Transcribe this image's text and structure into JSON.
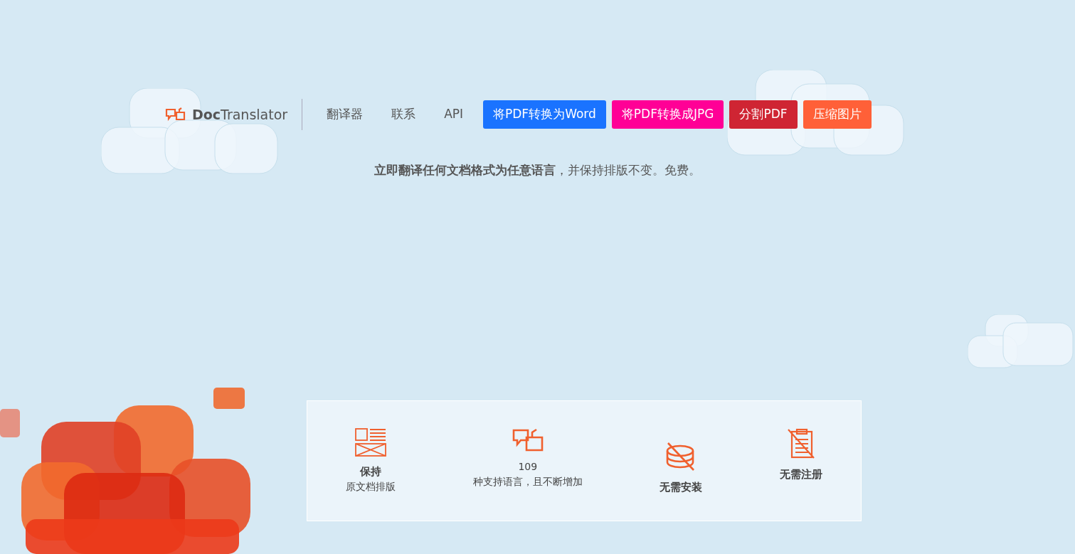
{
  "header": {
    "logo": "**Doc**Translator",
    "nav_links": [
      {
        "label": "翻译器"
      },
      {
        "label": "联系"
      },
      {
        "label": "API"
      }
    ],
    "nav_buttons": [
      {
        "label": "将PDF转换为Word",
        "color": "#1a73ff"
      },
      {
        "label": "将PDF转换成JPG",
        "color": "#ff0096"
      },
      {
        "label": "分割PDF",
        "color": "#cf2533"
      },
      {
        "label": "压缩图片",
        "color": "#ff6038"
      }
    ]
  },
  "tagline": "**立即翻译任何文档格式为任意语言**，并保持排版不变。免费。",
  "features": [
    {
      "kind": "layout",
      "title": "保持",
      "title_bold": true,
      "subtitle": "原文档排版"
    },
    {
      "kind": "languages",
      "title": "109",
      "title_bold": false,
      "subtitle": "种支持语言，且不断增加"
    },
    {
      "kind": "no-install",
      "title": "无需安装",
      "title_bold": true
    },
    {
      "kind": "no-signup",
      "title": "无需注册",
      "title_bold": true
    }
  ]
}
